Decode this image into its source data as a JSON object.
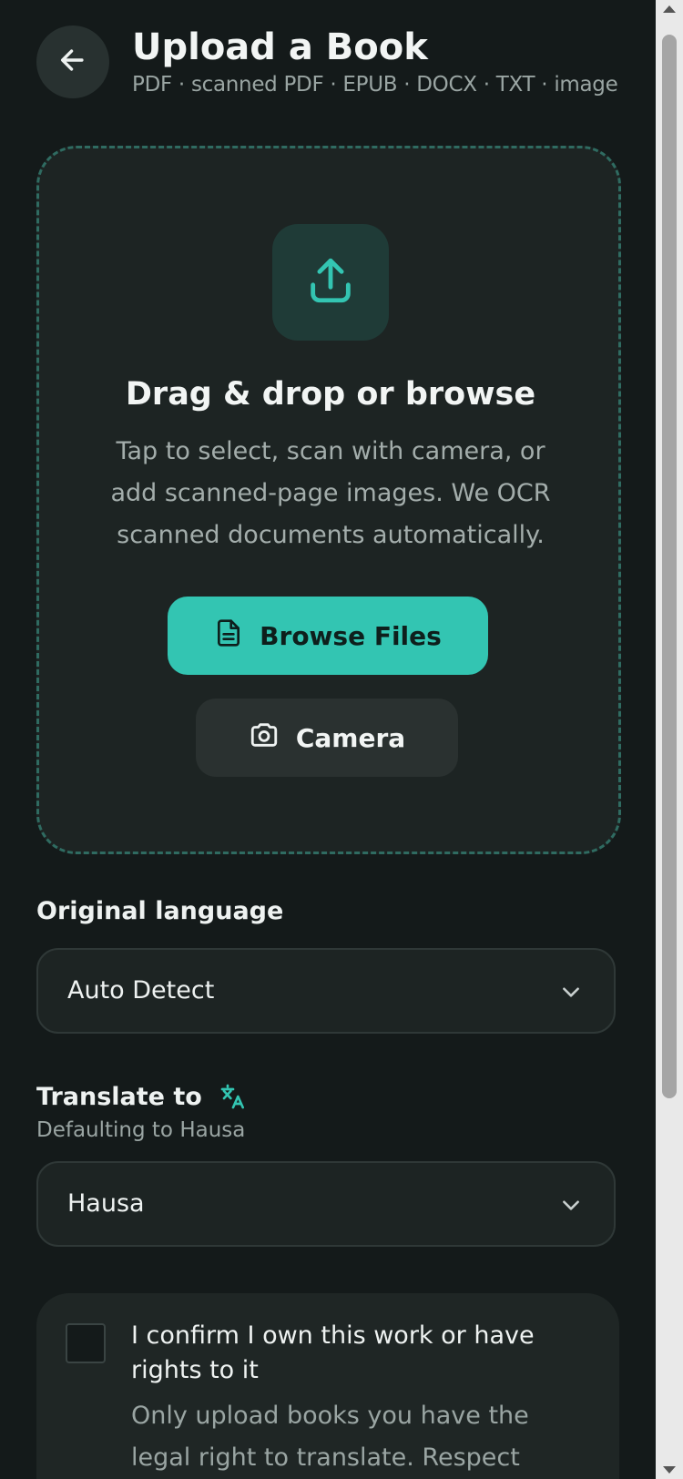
{
  "header": {
    "title": "Upload a Book",
    "subtitle": "PDF · scanned PDF · EPUB · DOCX · TXT · image",
    "back_icon": "arrow-left-icon"
  },
  "dropzone": {
    "icon": "upload-icon",
    "heading": "Drag & drop or browse",
    "description": "Tap to select, scan with camera, or add scanned-page images. We OCR scanned documents automatically.",
    "browse_label": "Browse Files",
    "browse_icon": "file-icon",
    "camera_label": "Camera",
    "camera_icon": "camera-icon"
  },
  "original_language": {
    "label": "Original language",
    "value": "Auto Detect"
  },
  "translate_to": {
    "label": "Translate to",
    "icon": "translate-icon",
    "hint": "Defaulting to Hausa",
    "value": "Hausa"
  },
  "confirm": {
    "checked": false,
    "title": "I confirm I own this work or have rights to it",
    "description": "Only upload books you have the legal right to translate. Respect copyright."
  },
  "colors": {
    "background": "#141a1a",
    "accent": "#33c5b2",
    "surface": "#1d2423",
    "muted_text": "#9aa5a3"
  }
}
